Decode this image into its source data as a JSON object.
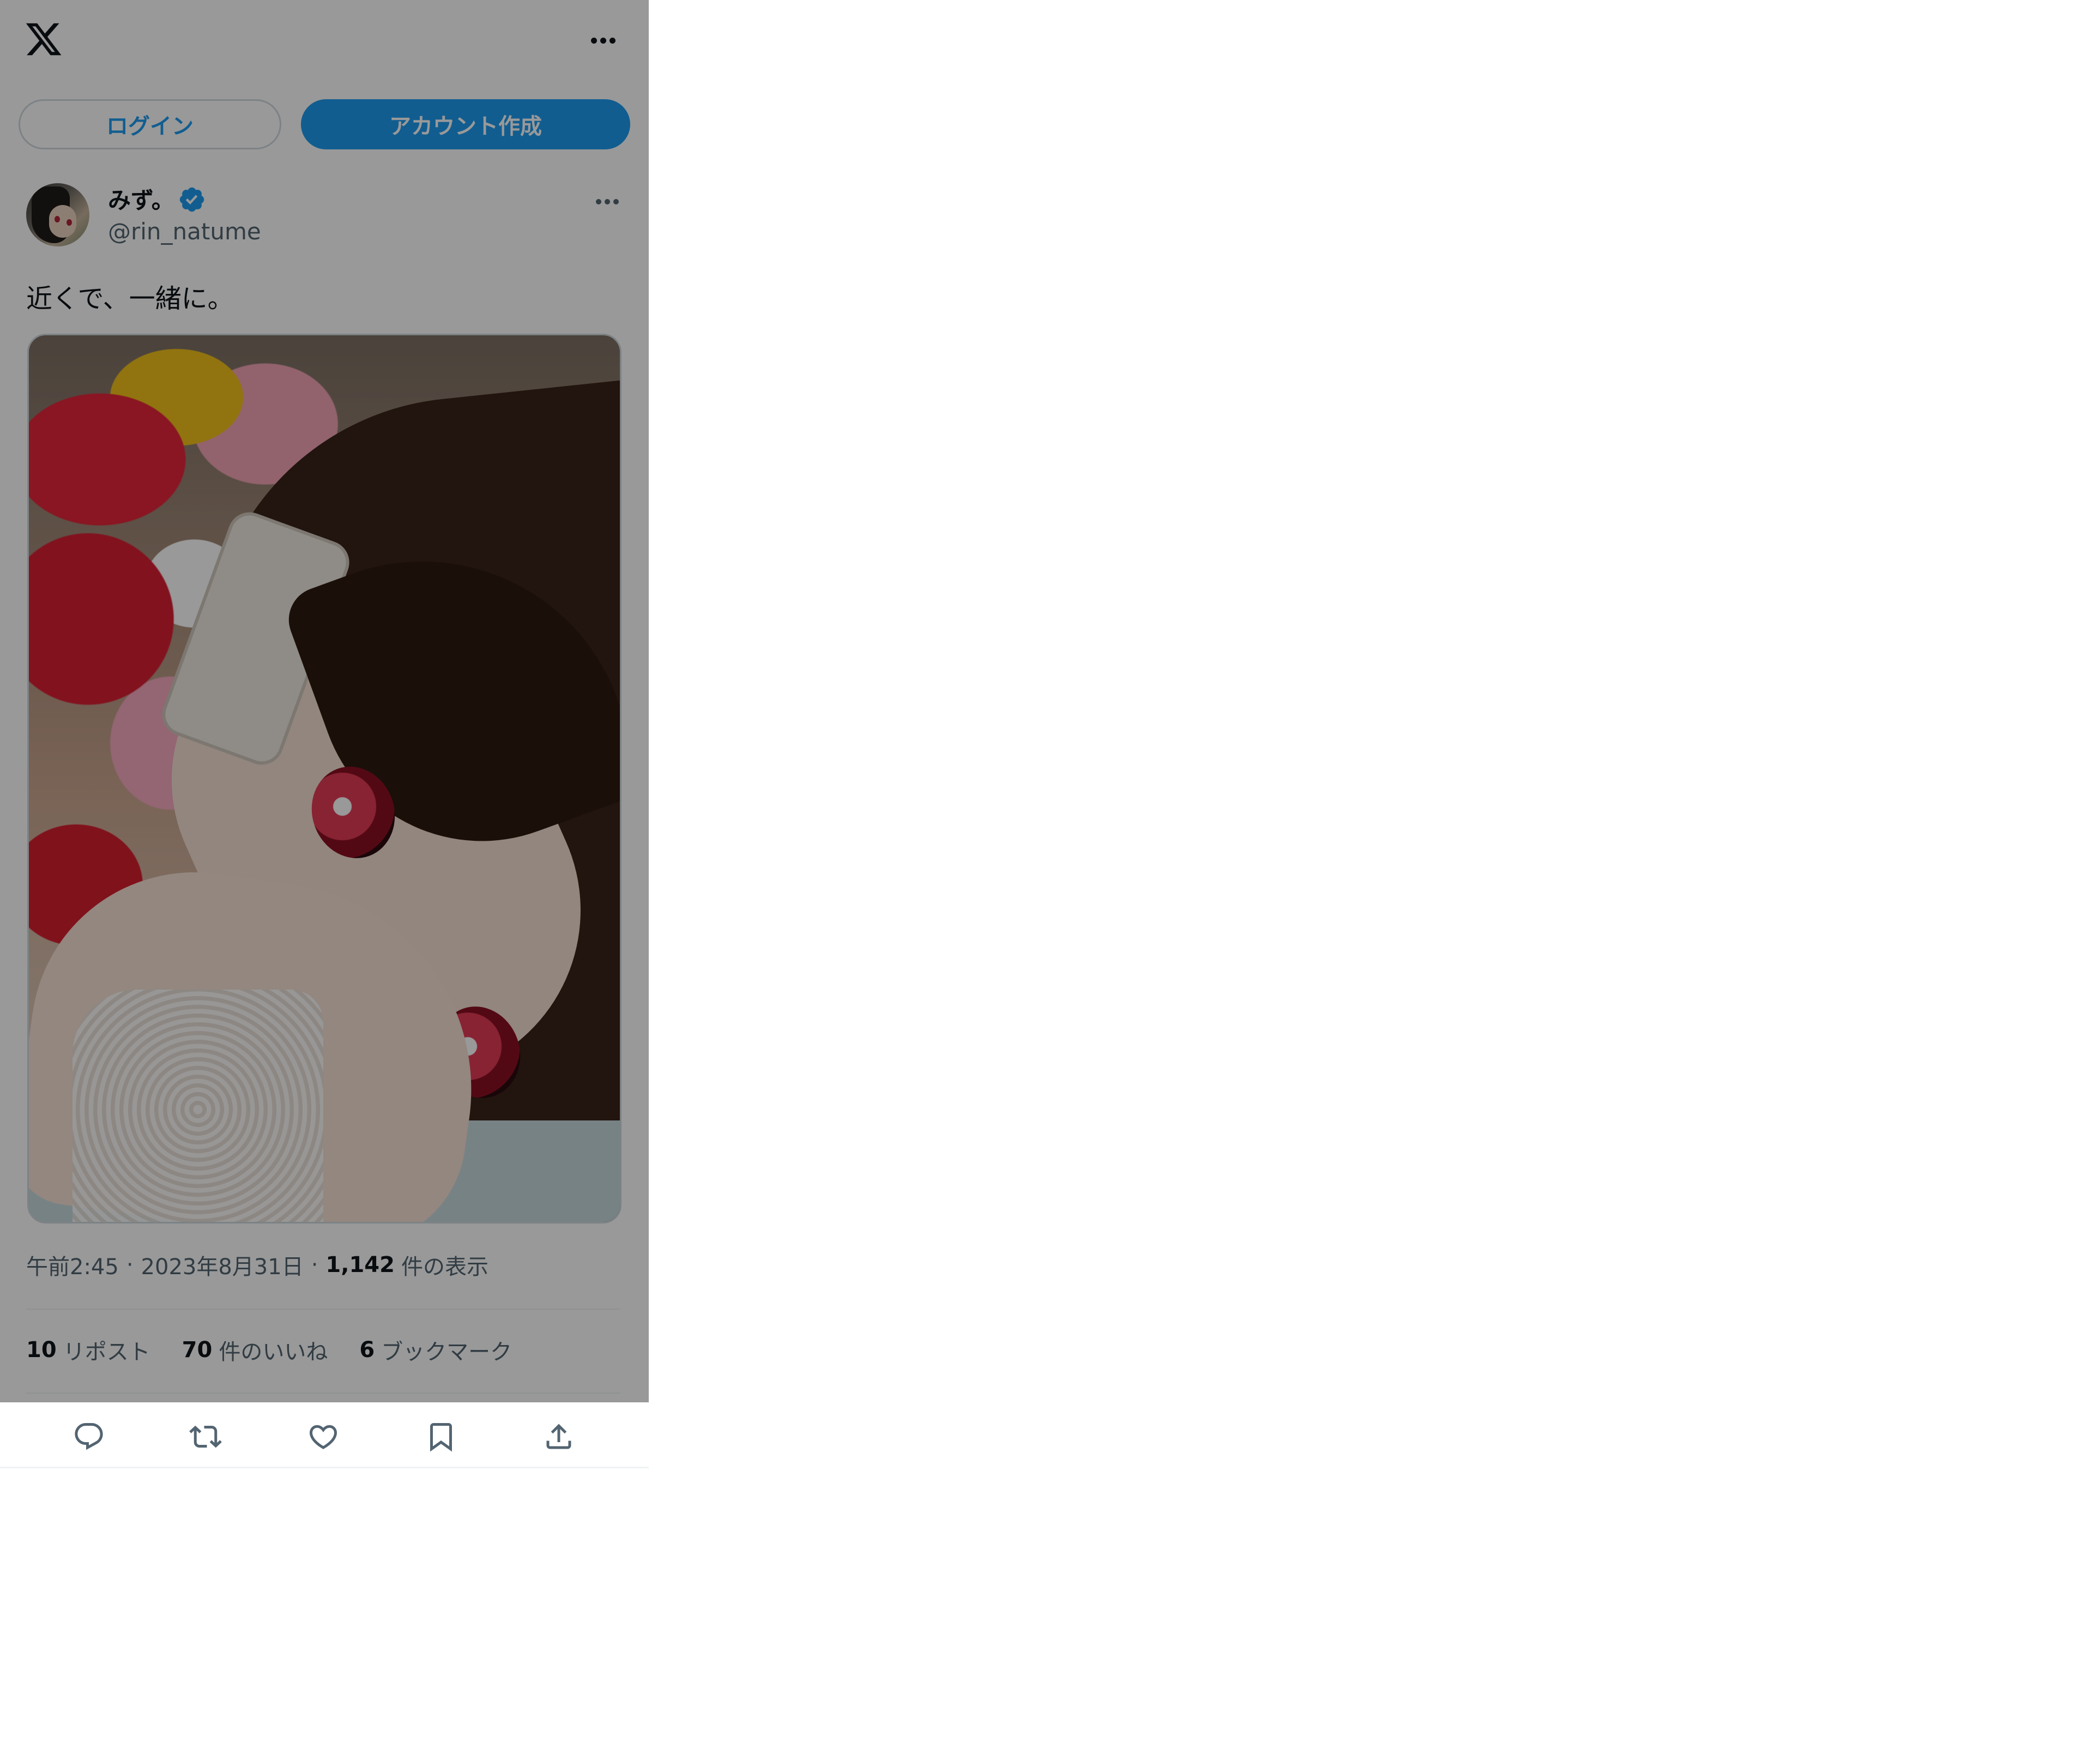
{
  "header": {
    "logo_icon": "x-logo-icon",
    "more_icon": "more-horizontal-icon"
  },
  "auth": {
    "login_label": "ログイン",
    "signup_label": "アカウント作成"
  },
  "tweet": {
    "author": {
      "display_name": "みず。",
      "verified_icon": "verified-badge-icon",
      "handle": "@rin_natume"
    },
    "text": "近くで、一緒に。",
    "media": {
      "type": "photo"
    },
    "meta": {
      "time": "午前2:45",
      "separator": "·",
      "date": "2023年8月31日",
      "views_count": "1,142",
      "views_label": "件の表示"
    },
    "stats": {
      "reposts_count": "10",
      "reposts_label": "リポスト",
      "likes_count": "70",
      "likes_label": "件のいいね",
      "bookmarks_count": "6",
      "bookmarks_label": "ブックマーク"
    },
    "actions": [
      {
        "icon": "reply-icon"
      },
      {
        "icon": "repost-icon"
      },
      {
        "icon": "like-icon"
      },
      {
        "icon": "bookmark-icon"
      },
      {
        "icon": "share-icon"
      }
    ]
  },
  "colors": {
    "accent": "#1d9bf0",
    "text_primary": "#0f1419",
    "text_secondary": "#536471",
    "overlay": "rgba(0,0,0,0.40)"
  }
}
